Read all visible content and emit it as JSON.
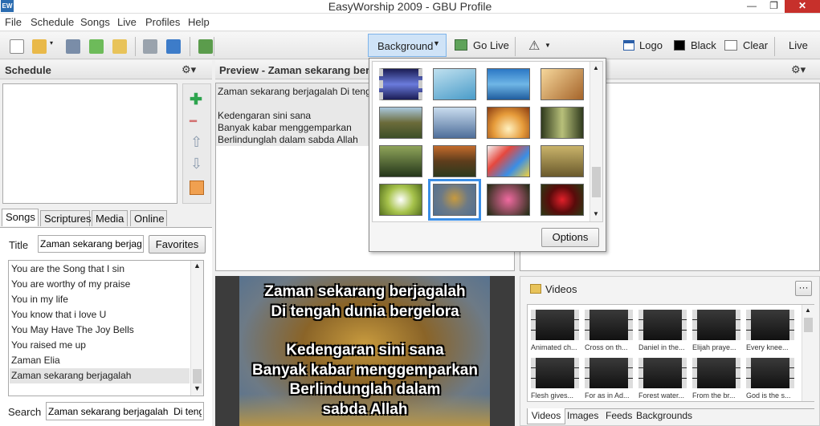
{
  "window": {
    "title": "EasyWorship 2009 - GBU Profile",
    "icon_text": "EW",
    "min_glyph": "—",
    "max_glyph": "❐",
    "close_glyph": "✕"
  },
  "menu": [
    "File",
    "Schedule",
    "Songs",
    "Live",
    "Profiles",
    "Help"
  ],
  "toolbar": {
    "background_label": "Background",
    "go_live_label": "Go Live",
    "logo_label": "Logo",
    "black_label": "Black",
    "clear_label": "Clear",
    "live_label": "Live"
  },
  "schedule": {
    "title": "Schedule",
    "gear_glyph": "⚙▾",
    "add": "✚",
    "remove": "━",
    "up": "⇧",
    "down": "⇩"
  },
  "library": {
    "tabs": [
      "Songs",
      "Scriptures",
      "Media",
      "Online"
    ],
    "title_label": "Title",
    "title_value": "Zaman sekarang berjagalah",
    "favorites_label": "Favorites",
    "songs": [
      "You are the Song that I sin",
      "You are worthy of my praise",
      "You in my life",
      "You know that i love U",
      "You May Have The Joy Bells",
      "You raised me up",
      "Zaman Elia",
      "Zaman sekarang berjagalah"
    ],
    "search_label": "Search",
    "search_value": "Zaman sekarang berjagalah  Di tengah"
  },
  "preview": {
    "title": "Preview - Zaman sekarang berjag",
    "lines": [
      "Zaman sekarang berjagalah  Di teng",
      "",
      "Kedengaran sini sana",
      "Banyak kabar menggemparkan",
      "Berlindunglah dalam sabda Allah"
    ],
    "slide_lines": [
      "Zaman sekarang berjagalah",
      "Di tengah dunia bergelora",
      "",
      "Kedengaran sini sana",
      "Banyak kabar menggemparkan",
      "Berlindunglah dalam",
      "sabda Allah"
    ]
  },
  "live": {
    "gear_glyph": "⚙▾"
  },
  "background_popup": {
    "options_label": "Options",
    "scroll_up": "▲",
    "scroll_down": "▼"
  },
  "media": {
    "header": "Videos",
    "more": "···",
    "videos_row1": [
      "Animated ch...",
      "Cross on th...",
      "Daniel in the...",
      "Elijah praye...",
      "Every knee..."
    ],
    "videos_row2": [
      "Flesh gives...",
      "For as in Ad...",
      "Forest water...",
      "From the br...",
      "God is the s..."
    ],
    "tabs": [
      "Videos",
      "Images",
      "Feeds",
      "Backgrounds"
    ]
  },
  "colors": {
    "accent": "#3a8ee6",
    "close": "#c7302b",
    "add": "#2da44e"
  }
}
